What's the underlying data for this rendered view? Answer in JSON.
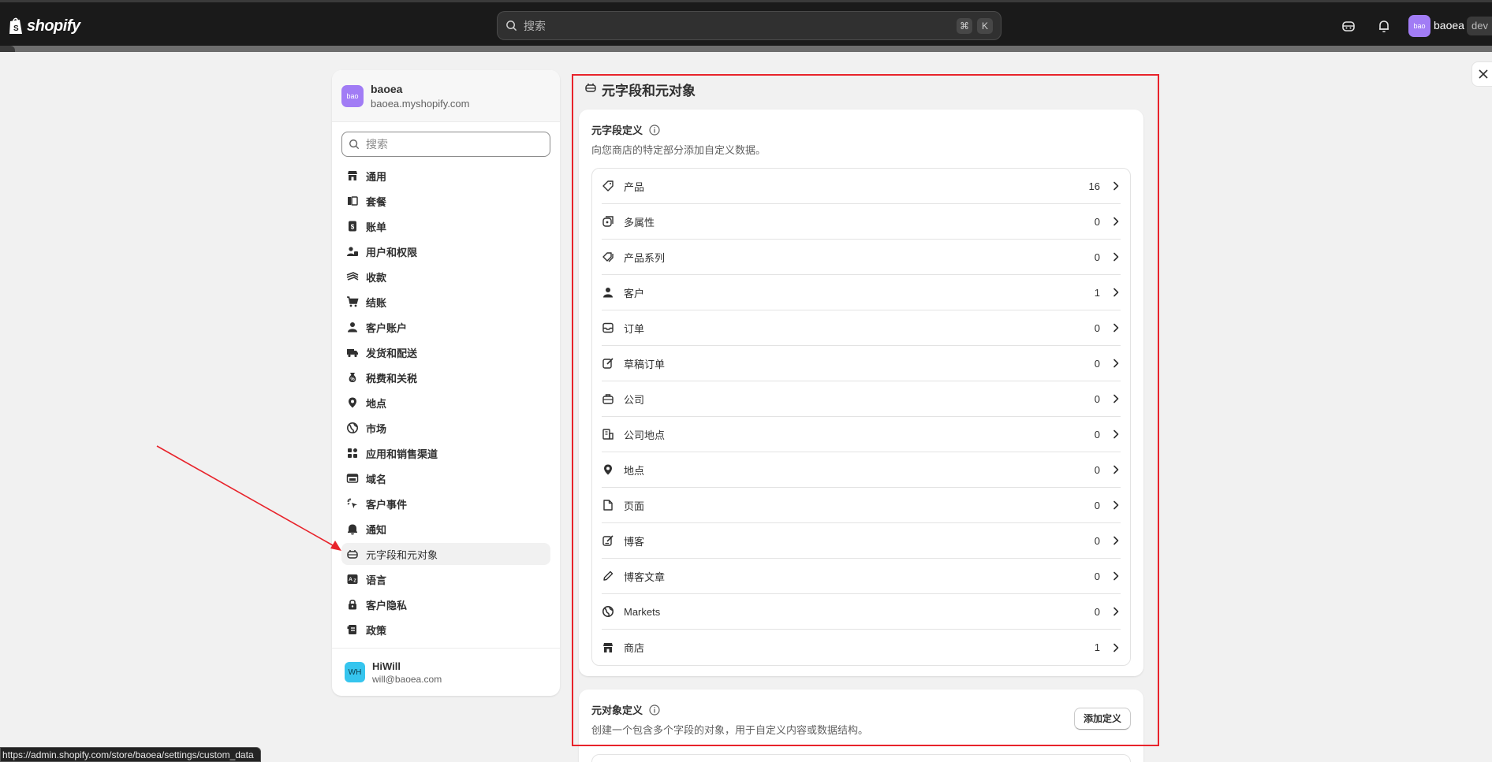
{
  "topbar": {
    "logo_text": "shopify",
    "search_placeholder": "搜索",
    "shortcut_keys": [
      "⌘",
      "K"
    ],
    "store_avatar": "bao",
    "store_name": "baoea",
    "dev_badge": "dev",
    "icons": [
      "assistant-icon",
      "bell-icon"
    ],
    "loading_progress_percent": 1
  },
  "sidebar": {
    "store": {
      "avatar": "bao",
      "name": "baoea",
      "domain": "baoea.myshopify.com"
    },
    "search_placeholder": "搜索",
    "items": [
      {
        "label": "通用",
        "icon": "store-icon"
      },
      {
        "label": "套餐",
        "icon": "plan-icon"
      },
      {
        "label": "账单",
        "icon": "billing-icon"
      },
      {
        "label": "用户和权限",
        "icon": "users-icon"
      },
      {
        "label": "收款",
        "icon": "payments-icon"
      },
      {
        "label": "结账",
        "icon": "cart-icon"
      },
      {
        "label": "客户账户",
        "icon": "person-icon"
      },
      {
        "label": "发货和配送",
        "icon": "truck-icon"
      },
      {
        "label": "税费和关税",
        "icon": "tax-icon"
      },
      {
        "label": "地点",
        "icon": "location-icon"
      },
      {
        "label": "市场",
        "icon": "globe-icon"
      },
      {
        "label": "应用和销售渠道",
        "icon": "apps-icon"
      },
      {
        "label": "域名",
        "icon": "domain-icon"
      },
      {
        "label": "客户事件",
        "icon": "cursor-icon"
      },
      {
        "label": "通知",
        "icon": "bell-icon"
      },
      {
        "label": "元字段和元对象",
        "icon": "metafield-icon",
        "active": true
      },
      {
        "label": "语言",
        "icon": "language-icon"
      },
      {
        "label": "客户隐私",
        "icon": "lock-icon"
      },
      {
        "label": "政策",
        "icon": "policy-icon"
      }
    ],
    "user": {
      "initials": "WH",
      "name": "HiWill",
      "email": "will@baoea.com"
    }
  },
  "main": {
    "title": "元字段和元对象",
    "metafields": {
      "heading": "元字段定义",
      "description": "向您商店的特定部分添加自定义数据。",
      "rows": [
        {
          "label": "产品",
          "count": "16",
          "icon": "tag-icon"
        },
        {
          "label": "多属性",
          "count": "0",
          "icon": "variant-icon"
        },
        {
          "label": "产品系列",
          "count": "0",
          "icon": "collection-icon"
        },
        {
          "label": "客户",
          "count": "1",
          "icon": "person-icon"
        },
        {
          "label": "订单",
          "count": "0",
          "icon": "order-icon"
        },
        {
          "label": "草稿订单",
          "count": "0",
          "icon": "draft-order-icon"
        },
        {
          "label": "公司",
          "count": "0",
          "icon": "company-icon"
        },
        {
          "label": "公司地点",
          "count": "0",
          "icon": "company-location-icon"
        },
        {
          "label": "地点",
          "count": "0",
          "icon": "location-icon"
        },
        {
          "label": "页面",
          "count": "0",
          "icon": "page-icon"
        },
        {
          "label": "博客",
          "count": "0",
          "icon": "blog-icon"
        },
        {
          "label": "博客文章",
          "count": "0",
          "icon": "pencil-icon"
        },
        {
          "label": "Markets",
          "count": "0",
          "icon": "globe-icon"
        },
        {
          "label": "商店",
          "count": "1",
          "icon": "store-icon"
        }
      ]
    },
    "metaobjects": {
      "heading": "元对象定义",
      "description": "创建一个包含多个字段的对象，用于自定义内容或数据结构。",
      "add_button": "添加定义"
    }
  },
  "status_url": "https://admin.shopify.com/store/baoea/settings/custom_data",
  "colors": {
    "highlight": "#e8232b",
    "topbar": "#1a1a1a",
    "avatar": "#a17cf5",
    "user_avatar": "#36c5ee"
  }
}
